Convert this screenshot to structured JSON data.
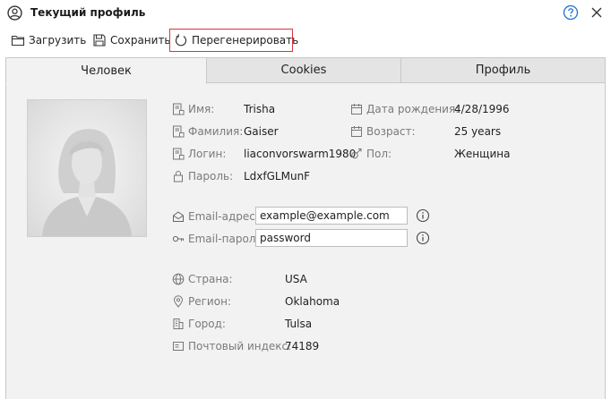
{
  "window": {
    "title": "Текущий профиль"
  },
  "toolbar": {
    "load_label": "Загрузить",
    "save_label": "Сохранить",
    "regenerate_label": "Перегенерировать"
  },
  "tabs": [
    {
      "label": "Человек",
      "active": true
    },
    {
      "label": "Cookies",
      "active": false
    },
    {
      "label": "Профиль",
      "active": false
    }
  ],
  "person": {
    "first_name": {
      "label": "Имя:",
      "value": "Trisha"
    },
    "last_name": {
      "label": "Фамилия:",
      "value": "Gaiser"
    },
    "login": {
      "label": "Логин:",
      "value": "liaconvorswarm1980"
    },
    "password": {
      "label": "Пароль:",
      "value": "LdxfGLMunF"
    },
    "birth_date": {
      "label": "Дата рождения:",
      "value": "4/28/1996"
    },
    "age": {
      "label": "Возраст:",
      "value": "25 years"
    },
    "gender": {
      "label": "Пол:",
      "value": "Женщина"
    },
    "email": {
      "label": "Email-адрес:",
      "value": "example@example.com"
    },
    "email_password": {
      "label": "Email-пароль:",
      "value": "password"
    },
    "country": {
      "label": "Страна:",
      "value": "USA"
    },
    "region": {
      "label": "Регион:",
      "value": "Oklahoma"
    },
    "city": {
      "label": "Город:",
      "value": "Tulsa"
    },
    "zip": {
      "label": "Почтовый индекс:",
      "value": "74189"
    }
  },
  "colors": {
    "regen_border": "#d9363e",
    "accent_blue": "#1e6fd0",
    "panel_bg": "#f2f2f2"
  }
}
